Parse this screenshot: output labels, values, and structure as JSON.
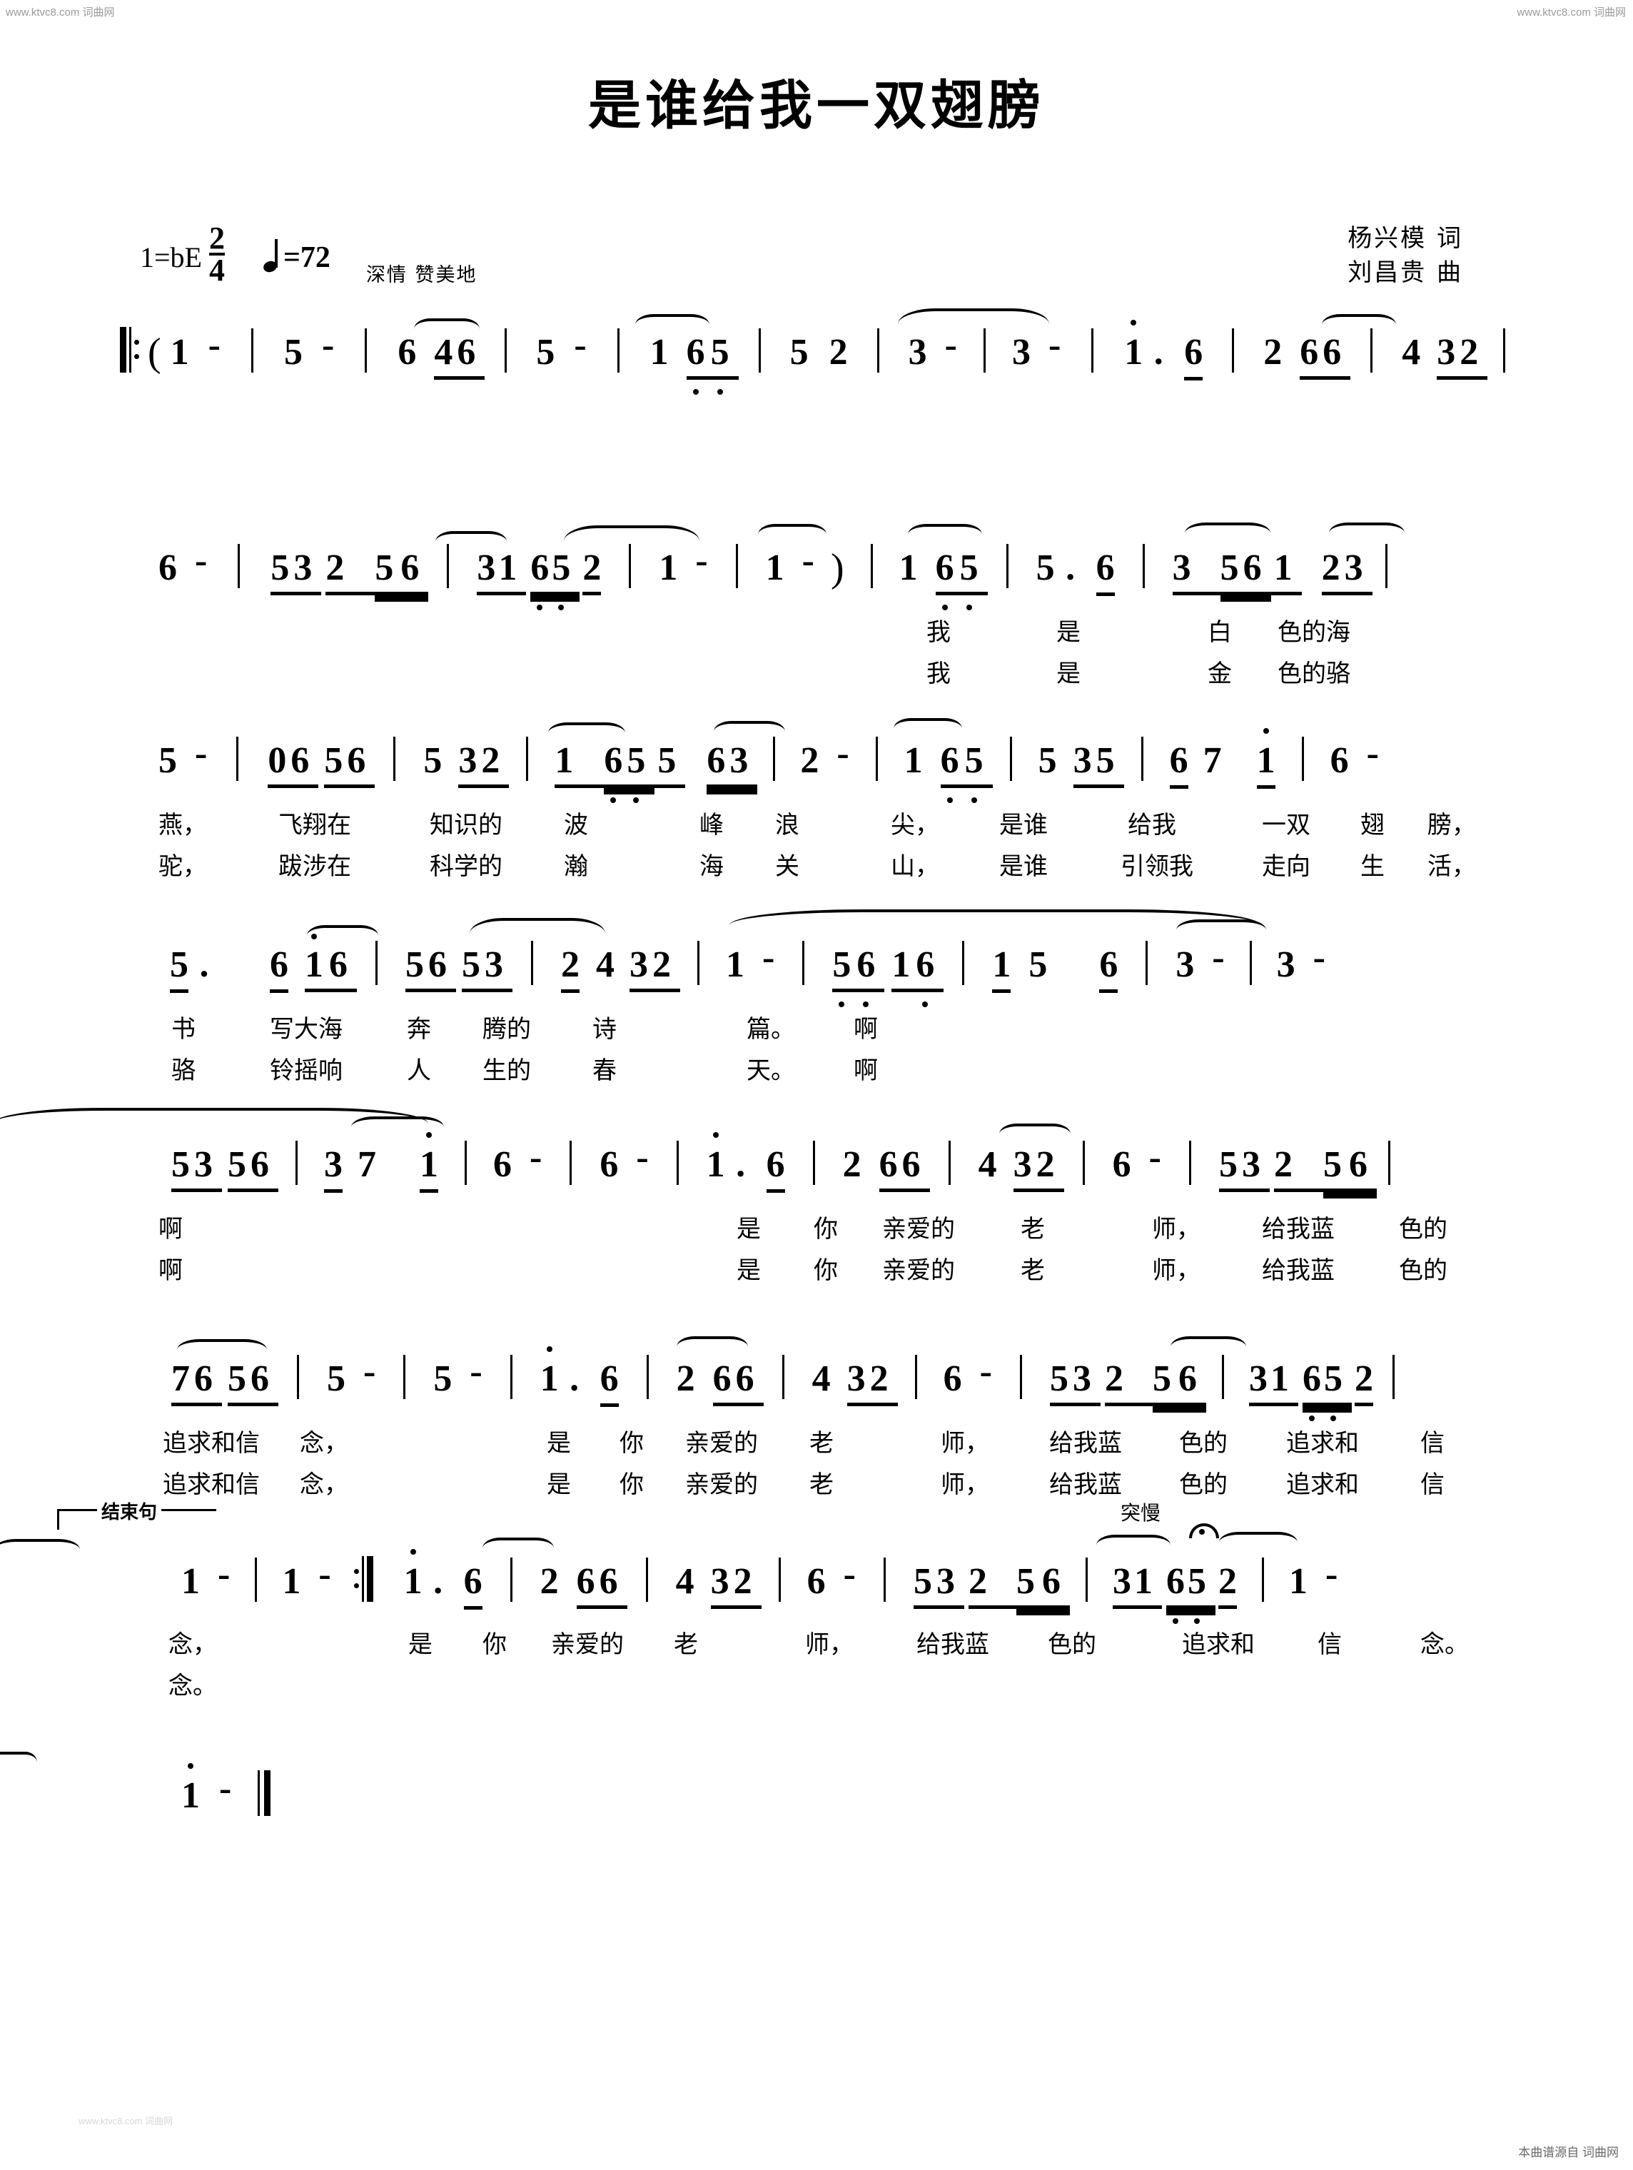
{
  "watermarks": {
    "top_left": "www.ktvc8.com 词曲网",
    "top_right": "www.ktvc8.com  词曲网",
    "bottom_right": "本曲谱源自  词曲网",
    "bottom_left": "www.ktvc8.com 词曲网"
  },
  "header": {
    "title": "是谁给我一双翅膀",
    "key_signature": "1=bE",
    "time_signature": {
      "numerator": "2",
      "denominator": "4"
    },
    "tempo": "=72",
    "expression": "深情  赞美地",
    "lyricist": "杨兴模  词",
    "composer": "刘昌贵  曲"
  },
  "marks": {
    "ending_phrase": "结束句",
    "sudden_slow": "突慢"
  },
  "chart_data": {
    "type": "table",
    "title": "是谁给我一双翅膀",
    "notation": "jianpu",
    "key": "1=bE",
    "meter": "2/4",
    "tempo_bpm": 72,
    "systems": [
      {
        "index": 1,
        "measures": [
          "(1 -",
          "5 -",
          "6 46",
          "5 -",
          "1 65",
          "5 2",
          "3 -",
          "3 -",
          "1̇ . 6",
          "2 66",
          "4 32"
        ],
        "lyrics_v1": "",
        "lyrics_v2": ""
      },
      {
        "index": 2,
        "measures": [
          "6 -",
          "5 3 2 5 6",
          "3 1 6 5 2",
          "1 -",
          "1 - )",
          "1 65",
          "5 . 6",
          "3 561 23"
        ],
        "lyrics_v1": "我    是    白 色的海",
        "lyrics_v2": "我    是    金 色的骆"
      },
      {
        "index": 3,
        "measures": [
          "5 -",
          "0656",
          "532",
          "1 655 63",
          "2 -",
          "1 65",
          "535",
          "67 1̇",
          "6 -"
        ],
        "lyrics_v1": "燕，  飞翔在 知识的 波  峰 浪 尖， 是谁 给我 一双 翅 膀，",
        "lyrics_v2": "驼，  跋涉在 科学的 瀚  海 关 山， 是谁 引领我 走向 生 活，"
      },
      {
        "index": 4,
        "measures": [
          "5 . 6 1̇6",
          "5653",
          "2432",
          "1 -",
          "5616",
          "15 6",
          "3 -",
          "3 -"
        ],
        "lyrics_v1": "书  写大海 奔 腾的 诗  篇。 啊",
        "lyrics_v2": "骆  铃摇响 人 生的 春  天。 啊"
      },
      {
        "index": 5,
        "measures": [
          "5356",
          "37 1̇",
          "6 -",
          "6 -",
          "1̇ . 6",
          "2 66",
          "4 32",
          "6 -",
          "5 3 2 5 6"
        ],
        "lyrics_v1": "啊        是 你 亲爱的 老  师， 给我蓝 色的",
        "lyrics_v2": "啊        是 你 亲爱的 老  师， 给我蓝 色的"
      },
      {
        "index": 6,
        "measures": [
          "7656",
          "5 -",
          "5 -",
          "1̇ . 6",
          "2 66",
          "4 32",
          "6 -",
          "5 3 2 5 6",
          "3 1 6 5 2"
        ],
        "lyrics_v1": "追求和信 念，     是 你 亲爱的 老  师， 给我蓝 色的 追求和 信",
        "lyrics_v2": "追求和信 念，     是 你 亲爱的 老  师， 给我蓝 色的 追求和 信"
      },
      {
        "index": 7,
        "measures": [
          "1 -",
          "1 - :||",
          "1̇ . 6",
          "2 66",
          "4 32",
          "6 -",
          "5 3 2 5 6",
          "3 1 6 5 2",
          "1 -"
        ],
        "lyrics_v1": "念，    是 你 亲爱的 老  师， 给我蓝 色的 追求和 信  念。",
        "lyrics_v2": "念。"
      },
      {
        "index": 8,
        "measures": [
          "1̇ -"
        ],
        "lyrics_v1": "",
        "lyrics_v2": ""
      }
    ]
  },
  "sys1": {
    "n1": "1",
    "n2": "5",
    "n3": "6",
    "n4": "4",
    "n5": "6",
    "n6": "5",
    "n7": "1",
    "n8": "6",
    "n9": "5",
    "n10": "5",
    "n11": "2",
    "n12": "3",
    "n13": "3",
    "n14": "1",
    "n15": "6",
    "n16": "2",
    "n17": "6",
    "n18": "6",
    "n19": "4",
    "n20": "3",
    "n21": "2",
    "dash": "-",
    "paren_open": "(",
    "dot": "."
  },
  "sys2": {
    "n1": "6",
    "n2": "5",
    "n3": "3",
    "n4": "2",
    "n5": "5",
    "n6": "6",
    "n7": "3",
    "n8": "1",
    "n9": "6",
    "n10": "5",
    "n11": "2",
    "n12": "1",
    "n13": "1",
    "n14": "1",
    "n15": "6",
    "n16": "5",
    "n17": "5",
    "n18": "6",
    "n19": "3",
    "n20": "5",
    "n21": "6",
    "n22": "1",
    "n23": "2",
    "n24": "3",
    "dash": "-",
    "paren_close": ")",
    "dot": ".",
    "ly1": "我",
    "ly2": "是",
    "ly3": "白",
    "ly4": "色的海",
    "ly5": "我",
    "ly6": "是",
    "ly7": "金",
    "ly8": "色的骆"
  },
  "sys3": {
    "n1": "5",
    "n2": "0",
    "n3": "6",
    "n4": "5",
    "n5": "6",
    "n6": "5",
    "n7": "3",
    "n8": "2",
    "n9": "1",
    "n10": "6",
    "n11": "5",
    "n12": "5",
    "n13": "6",
    "n14": "3",
    "n15": "2",
    "n16": "1",
    "n17": "6",
    "n18": "5",
    "n19": "5",
    "n20": "3",
    "n21": "5",
    "n22": "6",
    "n23": "7",
    "n24": "1",
    "n25": "6",
    "dash": "-",
    "ly1": "燕，",
    "ly2": "飞翔在",
    "ly3": "知识的",
    "ly4": "波",
    "ly5": "峰",
    "ly6": "浪",
    "ly7": "尖，",
    "ly8": "是谁",
    "ly9": "给我",
    "ly10": "一双",
    "ly11": "翅",
    "ly12": "膀，",
    "lyb1": "驼，",
    "lyb2": "跋涉在",
    "lyb3": "科学的",
    "lyb4": "瀚",
    "lyb5": "海",
    "lyb6": "关",
    "lyb7": "山，",
    "lyb8": "是谁",
    "lyb9": "引领我",
    "lyb10": "走向",
    "lyb11": "生",
    "lyb12": "活，"
  },
  "sys4": {
    "n1": "5",
    "n2": "6",
    "n3": "1",
    "n4": "6",
    "n5": "5",
    "n6": "6",
    "n7": "5",
    "n8": "3",
    "n9": "2",
    "n10": "4",
    "n11": "3",
    "n12": "2",
    "n13": "1",
    "n14": "5",
    "n15": "6",
    "n16": "1",
    "n17": "6",
    "n18": "1",
    "n19": "5",
    "n20": "6",
    "n21": "3",
    "n22": "3",
    "dash": "-",
    "dot": ".",
    "ly1": "书",
    "ly2": "写大海",
    "ly3": "奔",
    "ly4": "腾的",
    "ly5": "诗",
    "ly6": "篇。",
    "ly7": "啊",
    "lyb1": "骆",
    "lyb2": "铃摇响",
    "lyb3": "人",
    "lyb4": "生的",
    "lyb5": "春",
    "lyb6": "天。",
    "lyb7": "啊"
  },
  "sys5": {
    "n1": "5",
    "n2": "3",
    "n3": "5",
    "n4": "6",
    "n5": "3",
    "n6": "7",
    "n7": "1",
    "n8": "6",
    "n9": "6",
    "n10": "1",
    "n11": "6",
    "n12": "2",
    "n13": "6",
    "n14": "6",
    "n15": "4",
    "n16": "3",
    "n17": "2",
    "n18": "6",
    "n19": "5",
    "n20": "3",
    "n21": "2",
    "n22": "5",
    "n23": "6",
    "dash": "-",
    "dot": ".",
    "ly1": "啊",
    "ly2": "是",
    "ly3": "你",
    "ly4": "亲爱的",
    "ly5": "老",
    "ly6": "师，",
    "ly7": "给我蓝",
    "ly8": "色的",
    "lyb1": "啊",
    "lyb2": "是",
    "lyb3": "你",
    "lyb4": "亲爱的",
    "lyb5": "老",
    "lyb6": "师，",
    "lyb7": "给我蓝",
    "lyb8": "色的"
  },
  "sys6": {
    "n1": "7",
    "n2": "6",
    "n3": "5",
    "n4": "6",
    "n5": "5",
    "n6": "5",
    "n7": "1",
    "n8": "6",
    "n9": "2",
    "n10": "6",
    "n11": "6",
    "n12": "4",
    "n13": "3",
    "n14": "2",
    "n15": "6",
    "n16": "5",
    "n17": "3",
    "n18": "2",
    "n19": "5",
    "n20": "6",
    "n21": "3",
    "n22": "1",
    "n23": "6",
    "n24": "5",
    "n25": "2",
    "dash": "-",
    "dot": ".",
    "ly1": "追求和信",
    "ly2": "念，",
    "ly3": "是",
    "ly4": "你",
    "ly5": "亲爱的",
    "ly6": "老",
    "ly7": "师，",
    "ly8": "给我蓝",
    "ly9": "色的",
    "ly10": "追求和",
    "ly11": "信",
    "lyb1": "追求和信",
    "lyb2": "念，",
    "lyb3": "是",
    "lyb4": "你",
    "lyb5": "亲爱的",
    "lyb6": "老",
    "lyb7": "师，",
    "lyb8": "给我蓝",
    "lyb9": "色的",
    "lyb10": "追求和",
    "lyb11": "信"
  },
  "sys7": {
    "n1": "1",
    "n2": "1",
    "n3": "1",
    "n4": "6",
    "n5": "2",
    "n6": "6",
    "n7": "6",
    "n8": "4",
    "n9": "3",
    "n10": "2",
    "n11": "6",
    "n12": "5",
    "n13": "3",
    "n14": "2",
    "n15": "5",
    "n16": "6",
    "n17": "3",
    "n18": "1",
    "n19": "6",
    "n20": "5",
    "n21": "2",
    "n22": "1",
    "dash": "-",
    "dot": ".",
    "ly1": "念，",
    "ly2": "是",
    "ly3": "你",
    "ly4": "亲爱的",
    "ly5": "老",
    "ly6": "师，",
    "ly7": "给我蓝",
    "ly8": "色的",
    "ly9": "追求和",
    "ly10": "信",
    "ly11": "念。",
    "lyb1": "念。"
  },
  "sys8": {
    "n1": "1",
    "dash": "-"
  }
}
